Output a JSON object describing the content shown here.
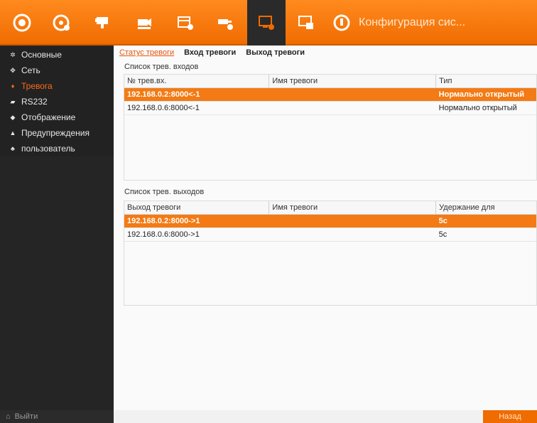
{
  "topbar": {
    "title": "Конфигурация сис...",
    "icons": [
      "playback-icon",
      "remote-config-icon",
      "camera-icon",
      "record-config-icon",
      "hdd-icon",
      "alarm-config-icon",
      "system-config-icon",
      "network-icon",
      "shutdown-icon"
    ],
    "accent": "#f06b00"
  },
  "sidebar": {
    "items": [
      {
        "label": "Основные",
        "icon": "gear-icon"
      },
      {
        "label": "Сеть",
        "icon": "network-icon"
      },
      {
        "label": "Тревога",
        "icon": "alarm-icon"
      },
      {
        "label": "RS232",
        "icon": "serial-icon"
      },
      {
        "label": "Отображение",
        "icon": "display-icon"
      },
      {
        "label": "Предупреждения",
        "icon": "warning-icon"
      },
      {
        "label": "пользователь",
        "icon": "users-icon"
      }
    ],
    "exit_label": "Выйти"
  },
  "tabs": [
    "Статус тревоги",
    "Вход тревоги",
    "Выход тревоги"
  ],
  "inputs": {
    "title": "Список трев. входов",
    "columns": [
      "№ трев.вх.",
      "Имя тревоги",
      "Тип"
    ],
    "rows": [
      [
        "192.168.0.2:8000<-1",
        "",
        "Нормально открытый"
      ],
      [
        "192.168.0.6:8000<-1",
        "",
        "Нормально открытый"
      ]
    ]
  },
  "outputs": {
    "title": "Список трев. выходов",
    "columns": [
      "Выход тревоги",
      "Имя тревоги",
      "Удержание для"
    ],
    "rows": [
      [
        "192.168.0.2:8000->1",
        "",
        "5с"
      ],
      [
        "192.168.0.6:8000->1",
        "",
        "5с"
      ]
    ]
  },
  "back_label": "Назад"
}
